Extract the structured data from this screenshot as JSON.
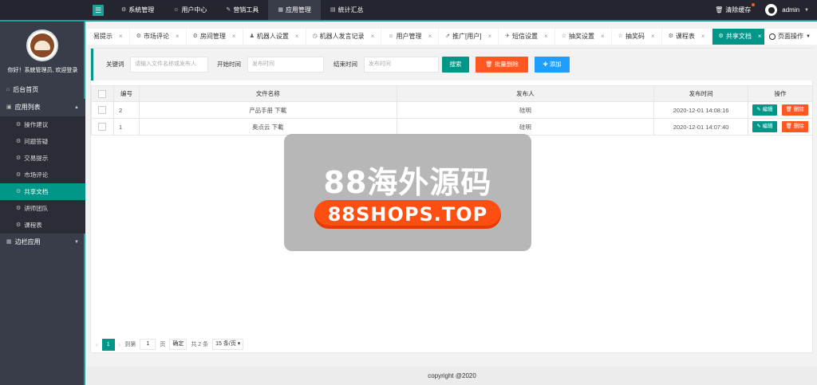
{
  "topbar": {
    "nav": [
      {
        "icon": "gear-icon",
        "glyph": "⚙",
        "label": "系統管理"
      },
      {
        "icon": "user-icon",
        "glyph": "☺",
        "label": "用户中心"
      },
      {
        "icon": "tools-icon",
        "glyph": "✎",
        "label": "营销工具"
      },
      {
        "icon": "apps-icon",
        "glyph": "▦",
        "label": "应用管理"
      },
      {
        "icon": "chat-icon",
        "glyph": "▤",
        "label": "統计汇总"
      }
    ],
    "clear_cache": "清除缓存",
    "username": "admin"
  },
  "sidebar": {
    "greeting": "你好！系統管理员, 欢迎登录",
    "home": "后台首页",
    "app_list": "应用列表",
    "sub_items": [
      "操作建议",
      "问题答疑",
      "交易提示",
      "市场评论",
      "共享文档",
      "讲师团队",
      "课程表"
    ],
    "active_sub": 4,
    "edge_apps": "边栏应用"
  },
  "tabs": [
    {
      "label": "易提示",
      "icon": ""
    },
    {
      "label": "市场评论",
      "icon": "⚙"
    },
    {
      "label": "房间管理",
      "icon": "⚙"
    },
    {
      "label": "机器人设置",
      "icon": "♟"
    },
    {
      "label": "机器人发言记录",
      "icon": "◷"
    },
    {
      "label": "用户管理",
      "icon": "☺"
    },
    {
      "label": "推广[用户]",
      "icon": "⇗"
    },
    {
      "label": "短信设置",
      "icon": "✈"
    },
    {
      "label": "抽奖设置",
      "icon": "☆"
    },
    {
      "label": "抽奖码",
      "icon": "☆"
    },
    {
      "label": "课程表",
      "icon": "⚙"
    },
    {
      "label": "共享文档",
      "icon": "⚙"
    }
  ],
  "active_tab": 11,
  "page_ops": "页面操作",
  "search": {
    "keyword_label": "关键词",
    "keyword_placeholder": "请输入文件名称或发布人",
    "start_label": "开始时间",
    "start_placeholder": "发布时间",
    "end_label": "结束时间",
    "end_placeholder": "发布时间",
    "search_btn": "搜索",
    "batch_delete_btn": "批量删除",
    "add_btn": "添加"
  },
  "table": {
    "headers": [
      "编号",
      "文件名称",
      "发布人",
      "发布时间",
      "操作"
    ],
    "rows": [
      {
        "id": "2",
        "name": "产品手册  下載",
        "publisher": "硅明",
        "time": "2020-12-01 14:08:16"
      },
      {
        "id": "1",
        "name": "奥点云  下載",
        "publisher": "硅明",
        "time": "2020-12-01 14:07:40"
      }
    ],
    "edit_label": "编辑",
    "delete_label": "删除"
  },
  "pager": {
    "current": "1",
    "goto_label": "到第",
    "goto_value": "1",
    "page_label": "页",
    "confirm": "确定",
    "total": "共 2 条",
    "per_page": "15 条/页"
  },
  "footer": "copyright @2020",
  "watermark": {
    "title": "88海外源码",
    "url": "88SHOPS.TOP"
  },
  "colors": {
    "accent": "#009688",
    "danger": "#ff5722",
    "info": "#1e9fff",
    "topbar": "#23262e",
    "sidebar": "#393d49"
  }
}
